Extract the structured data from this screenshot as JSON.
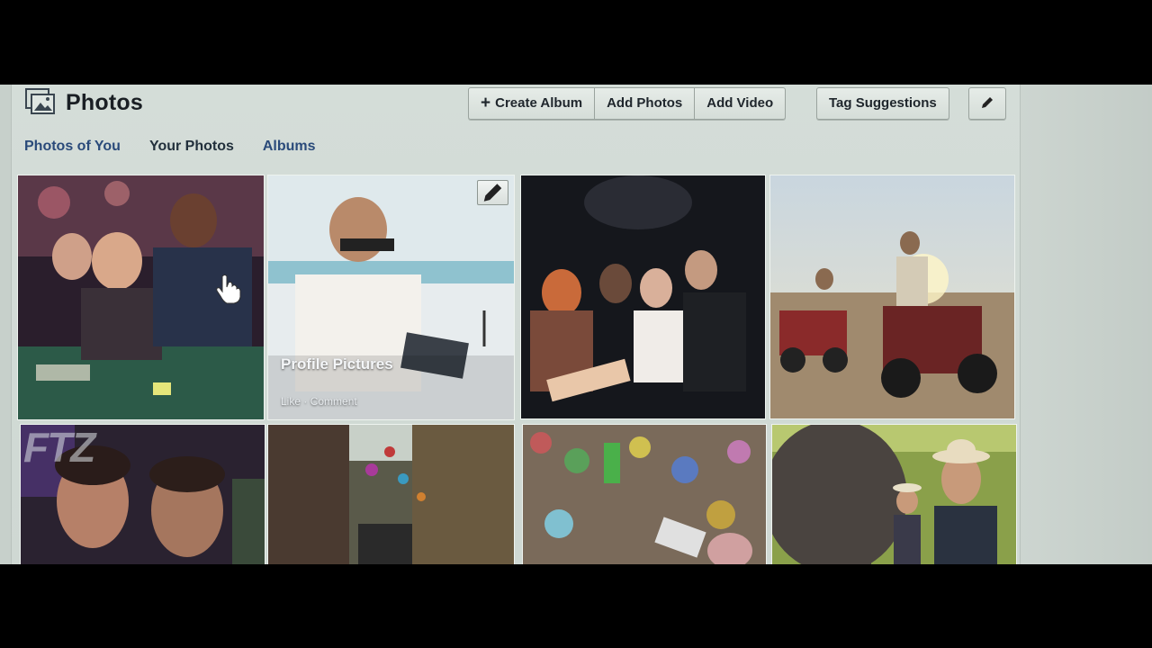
{
  "header": {
    "title": "Photos",
    "icon": "photos-icon",
    "buttons": {
      "create_album": "Create Album",
      "add_photos": "Add Photos",
      "add_video": "Add Video",
      "tag_suggestions": "Tag Suggestions"
    },
    "edit_icon": "pencil-icon"
  },
  "tabs": [
    {
      "label": "Photos of You"
    },
    {
      "label": "Your Photos",
      "active": true
    },
    {
      "label": "Albums"
    }
  ],
  "grid": {
    "album_overlay": {
      "caption": "Profile Pictures",
      "like": "Like",
      "separator": " · ",
      "comment": "Comment"
    }
  },
  "watermark": "FTZ",
  "colors": {
    "link_blue": "#2a4a7a",
    "panel_bg": "#d4ddd8"
  }
}
